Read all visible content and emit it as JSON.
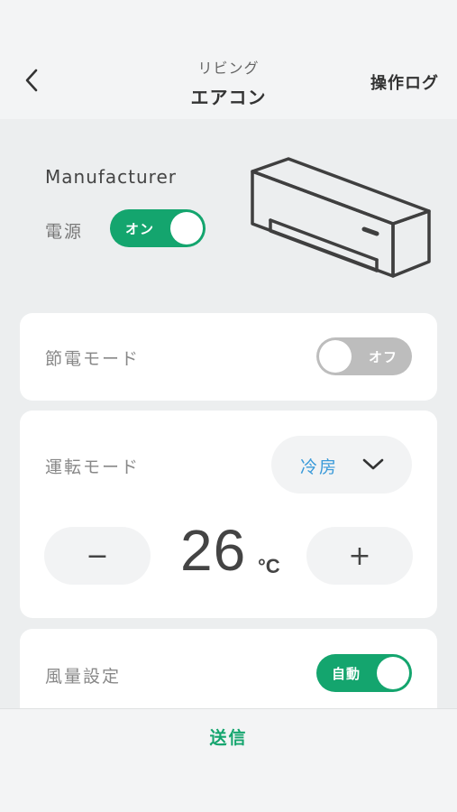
{
  "header": {
    "room": "リビング",
    "device": "エアコン",
    "log_link": "操作ログ"
  },
  "device": {
    "manufacturer": "Manufacturer",
    "power_label": "電源",
    "power_state": "オン"
  },
  "eco": {
    "label": "節電モード",
    "state": "オフ"
  },
  "operation": {
    "label": "運転モード",
    "mode": "冷房",
    "decrease": "−",
    "increase": "+",
    "temperature": "26",
    "unit": "°C"
  },
  "airflow": {
    "label": "風量設定",
    "state": "自動"
  },
  "footer": {
    "send": "送信"
  },
  "colors": {
    "accent": "#14a56e",
    "mode_text": "#3a9ad9",
    "toggle_off": "#bdbdbd"
  },
  "icons": {
    "back": "chevron-left-icon",
    "dropdown": "chevron-down-icon",
    "device": "air-conditioner-icon"
  }
}
